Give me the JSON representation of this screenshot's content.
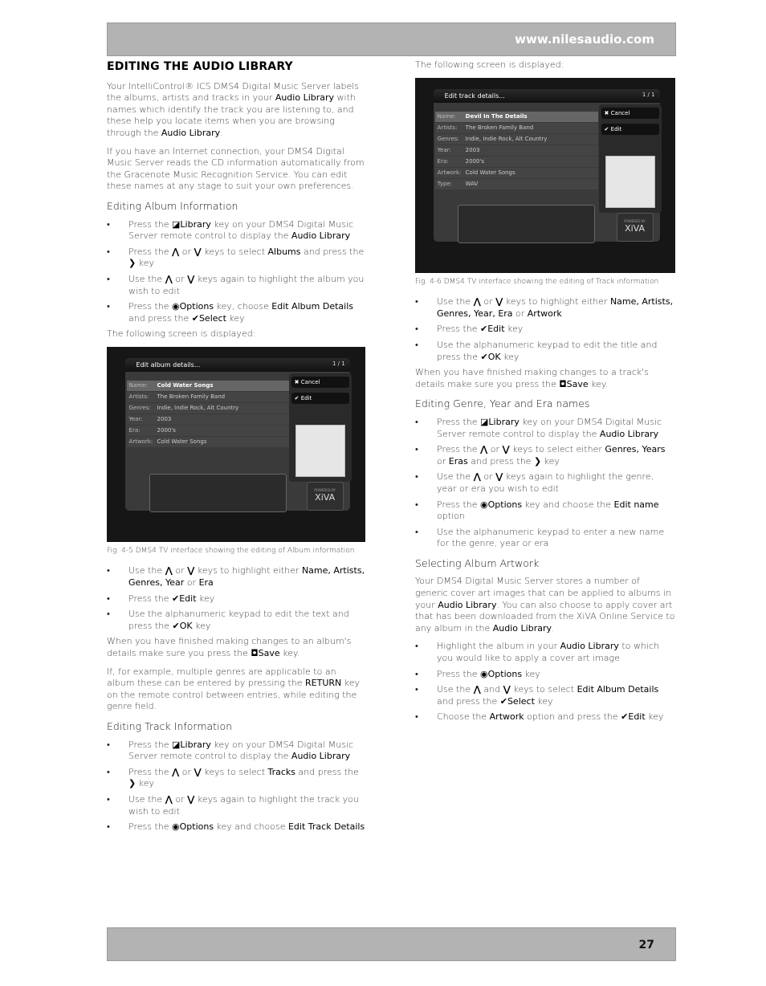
{
  "header": {
    "url": "www.nilesaudio.com"
  },
  "footer": {
    "page_number": "27"
  },
  "icons": {
    "lib": "library-key-icon",
    "up": "up-arrow-icon",
    "down": "down-arrow-icon",
    "right": "right-arrow-icon",
    "opt": "options-icon",
    "chk": "check-icon",
    "save": "save-icon"
  },
  "screens": {
    "album": {
      "title": "Edit album details...",
      "page": "1 / 1",
      "cancel": "Cancel",
      "edit": "Edit",
      "powered": "POWERED BY",
      "logo": "XiVA",
      "rows": [
        [
          "Name:",
          "Cold Water Songs"
        ],
        [
          "Artists:",
          "The Broken Family Band"
        ],
        [
          "Genres:",
          "Indie, Indie Rock, Alt Country"
        ],
        [
          "Year:",
          "2003"
        ],
        [
          "Era:",
          "2000's"
        ],
        [
          "Artwork:",
          "Cold Water Songs"
        ]
      ]
    },
    "track": {
      "title": "Edit track details...",
      "page": "1 / 1",
      "cancel": "Cancel",
      "edit": "Edit",
      "powered": "POWERED BY",
      "logo": "XiVA",
      "rows": [
        [
          "Name:",
          "Devil In The Details"
        ],
        [
          "Artists:",
          "The Broken Family Band"
        ],
        [
          "Genres:",
          "Indie, Indie Rock, Alt Country"
        ],
        [
          "Year:",
          "2003"
        ],
        [
          "Era:",
          "2000's"
        ],
        [
          "Artwork:",
          "Cold Water Songs"
        ],
        [
          "Type:",
          "WAV"
        ]
      ]
    }
  },
  "left": [
    {
      "t": "h",
      "s": [
        "EDITING THE AUDIO LIBRARY"
      ]
    },
    {
      "t": "p",
      "s": [
        "Your IntelliControl® ICS DMS4 Digital Music Server labels the albums, artists and tracks in your ",
        {
          "k": "Audio Library"
        },
        " with names which identify the track you are listening to, and these help you locate items when you are browsing through the ",
        {
          "k": "Audio Library"
        },
        "."
      ]
    },
    {
      "t": "p",
      "s": [
        "If you have an Internet connection, your DMS4 Digital Music Server reads the CD information automatically from the Gracenote Music Recognition Service.  You can edit these names at any stage to suit your own preferences."
      ]
    },
    {
      "t": "sh",
      "s": [
        "Editing Album Information"
      ]
    },
    {
      "t": "li",
      "s": [
        "Press the ",
        {
          "i": "lib"
        },
        {
          "k": "Library"
        },
        " key on your DMS4 Digital Music Server remote control to display the ",
        {
          "k": "Audio Library"
        }
      ]
    },
    {
      "t": "li",
      "s": [
        "Press the ",
        {
          "i": "up"
        },
        " or ",
        {
          "i": "down"
        },
        " keys to select ",
        {
          "k": "Albums"
        },
        " and press the ",
        {
          "i": "right"
        },
        " key"
      ]
    },
    {
      "t": "li",
      "s": [
        "Use the ",
        {
          "i": "up"
        },
        " or ",
        {
          "i": "down"
        },
        " keys again to highlight the album you wish to edit"
      ]
    },
    {
      "t": "li",
      "s": [
        "Press the ",
        {
          "i": "opt"
        },
        {
          "k": "Options"
        },
        " key, choose ",
        {
          "k": "Edit Album Details"
        },
        " and press the ",
        {
          "i": "chk"
        },
        {
          "k": "Select"
        },
        " key"
      ]
    },
    {
      "t": "p",
      "s": [
        "The following screen is displayed:"
      ]
    },
    {
      "t": "shot",
      "id": "album"
    },
    {
      "t": "cap",
      "s": [
        "Fig. 4-5  DMS4 TV interface showing the editing of Album information"
      ]
    },
    {
      "t": "li",
      "s": [
        "Use the ",
        {
          "i": "up"
        },
        " or ",
        {
          "i": "down"
        },
        " keys to highlight either ",
        {
          "k": "Name, Artists, Genres, Year"
        },
        " or ",
        {
          "k": "Era"
        }
      ]
    },
    {
      "t": "li",
      "s": [
        "Press the ",
        {
          "i": "chk"
        },
        {
          "k": "Edit"
        },
        " key"
      ]
    },
    {
      "t": "li",
      "s": [
        "Use the alphanumeric keypad to edit the text and press the ",
        {
          "i": "chk"
        },
        {
          "k": "OK"
        },
        " key"
      ]
    },
    {
      "t": "p",
      "s": [
        "When you have finished making changes to an album's details make sure you press the ",
        {
          "i": "save"
        },
        {
          "k": "Save"
        },
        " key."
      ]
    },
    {
      "t": "p",
      "s": [
        "If, for example, multiple genres are applicable to an album these can be entered by pressing the ",
        {
          "k": "RETURN"
        },
        " key on the remote control between entries, while editing the genre field."
      ]
    },
    {
      "t": "sh",
      "s": [
        "Editing Track Information"
      ]
    },
    {
      "t": "li",
      "s": [
        "Press the ",
        {
          "i": "lib"
        },
        {
          "k": "Library"
        },
        " key on your DMS4 Digital Music Server remote control to display the ",
        {
          "k": "Audio Library"
        }
      ]
    },
    {
      "t": "li",
      "s": [
        "Press the ",
        {
          "i": "up"
        },
        " or ",
        {
          "i": "down"
        },
        " keys to select ",
        {
          "k": "Tracks"
        },
        " and press the ",
        {
          "i": "right"
        },
        " key"
      ]
    },
    {
      "t": "li",
      "s": [
        "Use the ",
        {
          "i": "up"
        },
        " or ",
        {
          "i": "down"
        },
        " keys again to highlight the track you wish to edit"
      ]
    },
    {
      "t": "li",
      "s": [
        "Press the ",
        {
          "i": "opt"
        },
        {
          "k": "Options"
        },
        " key and choose ",
        {
          "k": "Edit Track Details"
        }
      ]
    }
  ],
  "right": [
    {
      "t": "p",
      "s": [
        "The following screen is displayed:"
      ]
    },
    {
      "t": "shot",
      "id": "track"
    },
    {
      "t": "cap",
      "s": [
        "Fig. 4-6  DMS4 TV interface showing the editing of Track information"
      ]
    },
    {
      "t": "li",
      "s": [
        "Use the ",
        {
          "i": "up"
        },
        " or ",
        {
          "i": "down"
        },
        " keys to highlight either ",
        {
          "k": "Name, Artists, Genres, Year, Era"
        },
        " or ",
        {
          "k": "Artwork"
        }
      ]
    },
    {
      "t": "li",
      "s": [
        "Press the ",
        {
          "i": "chk"
        },
        {
          "k": "Edit"
        },
        " key"
      ]
    },
    {
      "t": "li",
      "s": [
        "Use the alphanumeric keypad to edit the title and press the ",
        {
          "i": "chk"
        },
        {
          "k": "OK"
        },
        " key"
      ]
    },
    {
      "t": "p",
      "s": [
        "When you have finished making changes to a track's details make sure you press the ",
        {
          "i": "save"
        },
        {
          "k": "Save"
        },
        " key."
      ]
    },
    {
      "t": "sh",
      "s": [
        "Editing Genre, Year and Era names"
      ]
    },
    {
      "t": "li",
      "s": [
        "Press the ",
        {
          "i": "lib"
        },
        {
          "k": "Library"
        },
        " key on your DMS4 Digital Music Server remote control to display the ",
        {
          "k": "Audio Library"
        }
      ]
    },
    {
      "t": "li",
      "s": [
        "Press the ",
        {
          "i": "up"
        },
        " or ",
        {
          "i": "down"
        },
        " keys to select either ",
        {
          "k": "Genres, Years"
        },
        "  or ",
        {
          "k": "Eras"
        },
        " and press the ",
        {
          "i": "right"
        },
        " key"
      ]
    },
    {
      "t": "li",
      "s": [
        "Use the ",
        {
          "i": "up"
        },
        " or ",
        {
          "i": "down"
        },
        " keys again to highlight the genre, year or era you wish to edit"
      ]
    },
    {
      "t": "li",
      "s": [
        "Press the ",
        {
          "i": "opt"
        },
        {
          "k": "Options"
        },
        " key and choose the ",
        {
          "k": "Edit name"
        },
        " option"
      ]
    },
    {
      "t": "li",
      "s": [
        "Use the alphanumeric keypad to enter a new name for the genre, year or era"
      ]
    },
    {
      "t": "sh",
      "s": [
        "Selecting Album Artwork"
      ]
    },
    {
      "t": "p",
      "s": [
        "Your DMS4 Digital Music Server stores a number of generic cover art images that can be applied to albums in your ",
        {
          "k": "Audio Library"
        },
        ".  You can also choose to apply cover art that has been downloaded from the XiVA Online Service to any album in the ",
        {
          "k": "Audio Library"
        },
        "."
      ]
    },
    {
      "t": "li",
      "s": [
        "Highlight the album in your ",
        {
          "k": "Audio Library"
        },
        " to which you would like to apply a cover art image"
      ]
    },
    {
      "t": "li",
      "s": [
        "Press the ",
        {
          "i": "opt"
        },
        {
          "k": "Options"
        },
        " key"
      ]
    },
    {
      "t": "li",
      "s": [
        "Use the ",
        {
          "i": "up"
        },
        " and ",
        {
          "i": "down"
        },
        " keys to select ",
        {
          "k": "Edit Album Details"
        },
        " and press the ",
        {
          "i": "chk"
        },
        {
          "k": "Select"
        },
        " key"
      ]
    },
    {
      "t": "li",
      "s": [
        "Choose the ",
        {
          "k": "Artwork"
        },
        " option and press the ",
        {
          "i": "chk"
        },
        {
          "k": "Edit"
        },
        " key"
      ]
    }
  ]
}
